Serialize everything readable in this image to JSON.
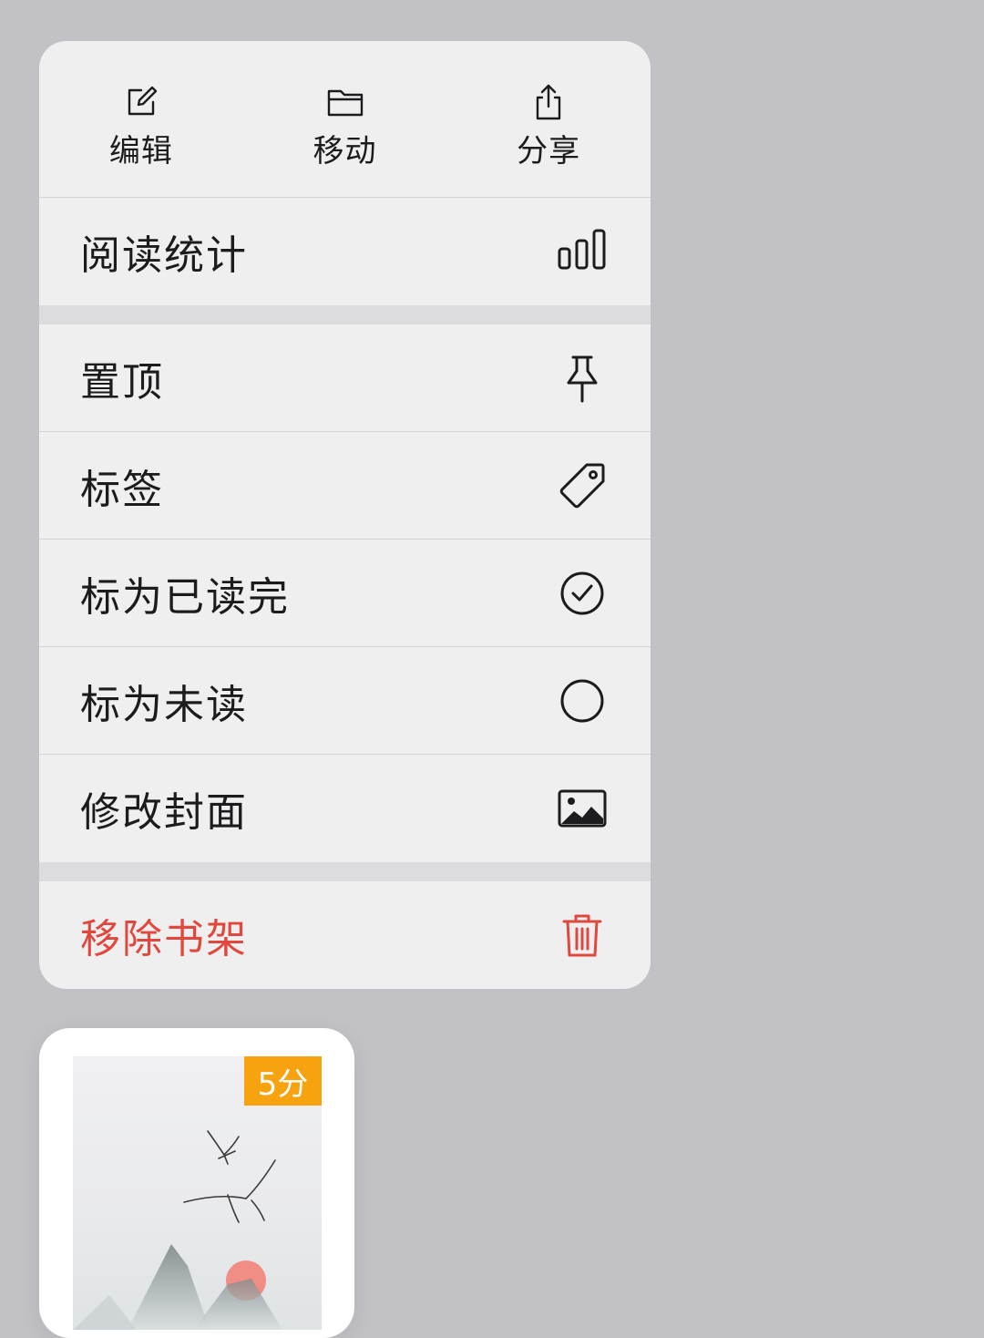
{
  "quick_actions": [
    {
      "label": "编辑",
      "icon": "edit-icon"
    },
    {
      "label": "移动",
      "icon": "folder-icon"
    },
    {
      "label": "分享",
      "icon": "share-icon"
    }
  ],
  "items": [
    {
      "label": "阅读统计",
      "icon": "bar-chart-icon"
    },
    {
      "label": "置顶",
      "icon": "pin-icon"
    },
    {
      "label": "标签",
      "icon": "tag-icon"
    },
    {
      "label": "标为已读完",
      "icon": "check-circle-icon"
    },
    {
      "label": "标为未读",
      "icon": "circle-icon"
    },
    {
      "label": "修改封面",
      "icon": "image-icon"
    },
    {
      "label": "移除书架",
      "icon": "trash-icon"
    }
  ],
  "colors": {
    "danger": "#e0483e",
    "badge": "#f7a20f"
  },
  "book": {
    "badge": "5分"
  }
}
